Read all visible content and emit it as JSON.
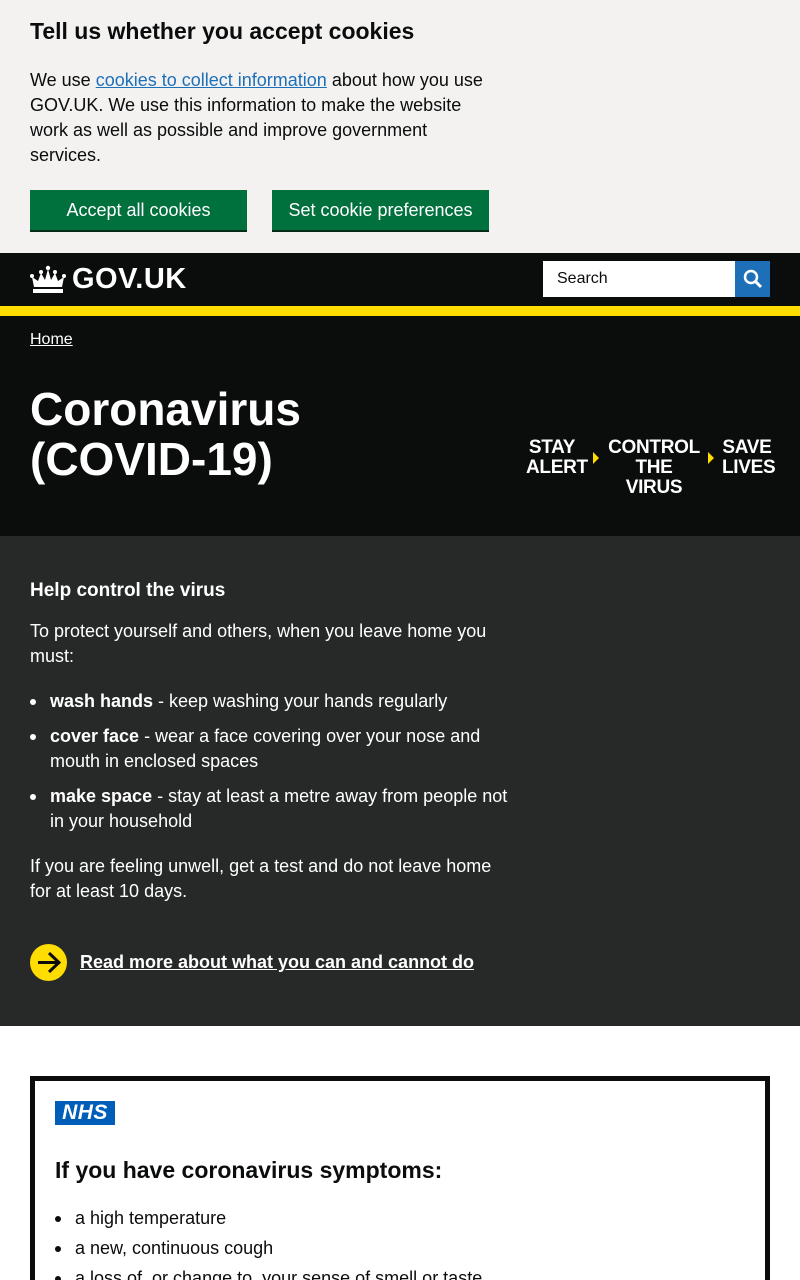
{
  "cookie_banner": {
    "title": "Tell us whether you accept cookies",
    "text_prefix": "We use ",
    "link_text": "cookies to collect information",
    "text_suffix": " about how you use GOV.UK. We use this information to make the website work as well as possible and improve government services.",
    "accept_label": "Accept all cookies",
    "preferences_label": "Set cookie preferences"
  },
  "header": {
    "logo_text": "GOV.UK",
    "search_placeholder": "Search"
  },
  "hero": {
    "breadcrumb": "Home",
    "title": "Coronavirus (COVID-19)",
    "slogan": [
      "STAY ALERT",
      "CONTROL THE VIRUS",
      "SAVE LIVES"
    ]
  },
  "help": {
    "heading": "Help control the virus",
    "intro": "To protect yourself and others, when you leave home you must:",
    "items": [
      {
        "bold": "wash hands",
        "text": " - keep washing your hands regularly"
      },
      {
        "bold": "cover face",
        "text": " - wear a face covering over your nose and mouth in enclosed spaces"
      },
      {
        "bold": "make space",
        "text": " - stay at least a metre away from people not in your household"
      }
    ],
    "unwell": "If you are feeling unwell, get a test and do not leave home for at least 10 days.",
    "read_more": "Read more about what you can and cannot do"
  },
  "nhs": {
    "logo": "NHS",
    "heading": "If you have coronavirus symptoms:",
    "symptoms": [
      "a high temperature",
      "a new, continuous cough",
      "a loss of, or change to, your sense of smell or taste"
    ]
  },
  "colors": {
    "govuk_black": "#0b0c0c",
    "govuk_yellow": "#ffdd00",
    "govuk_green": "#00703c",
    "govuk_blue": "#1d70b8",
    "nhs_blue": "#005eb8",
    "help_bg": "#272929",
    "cookie_bg": "#f3f2f1"
  }
}
